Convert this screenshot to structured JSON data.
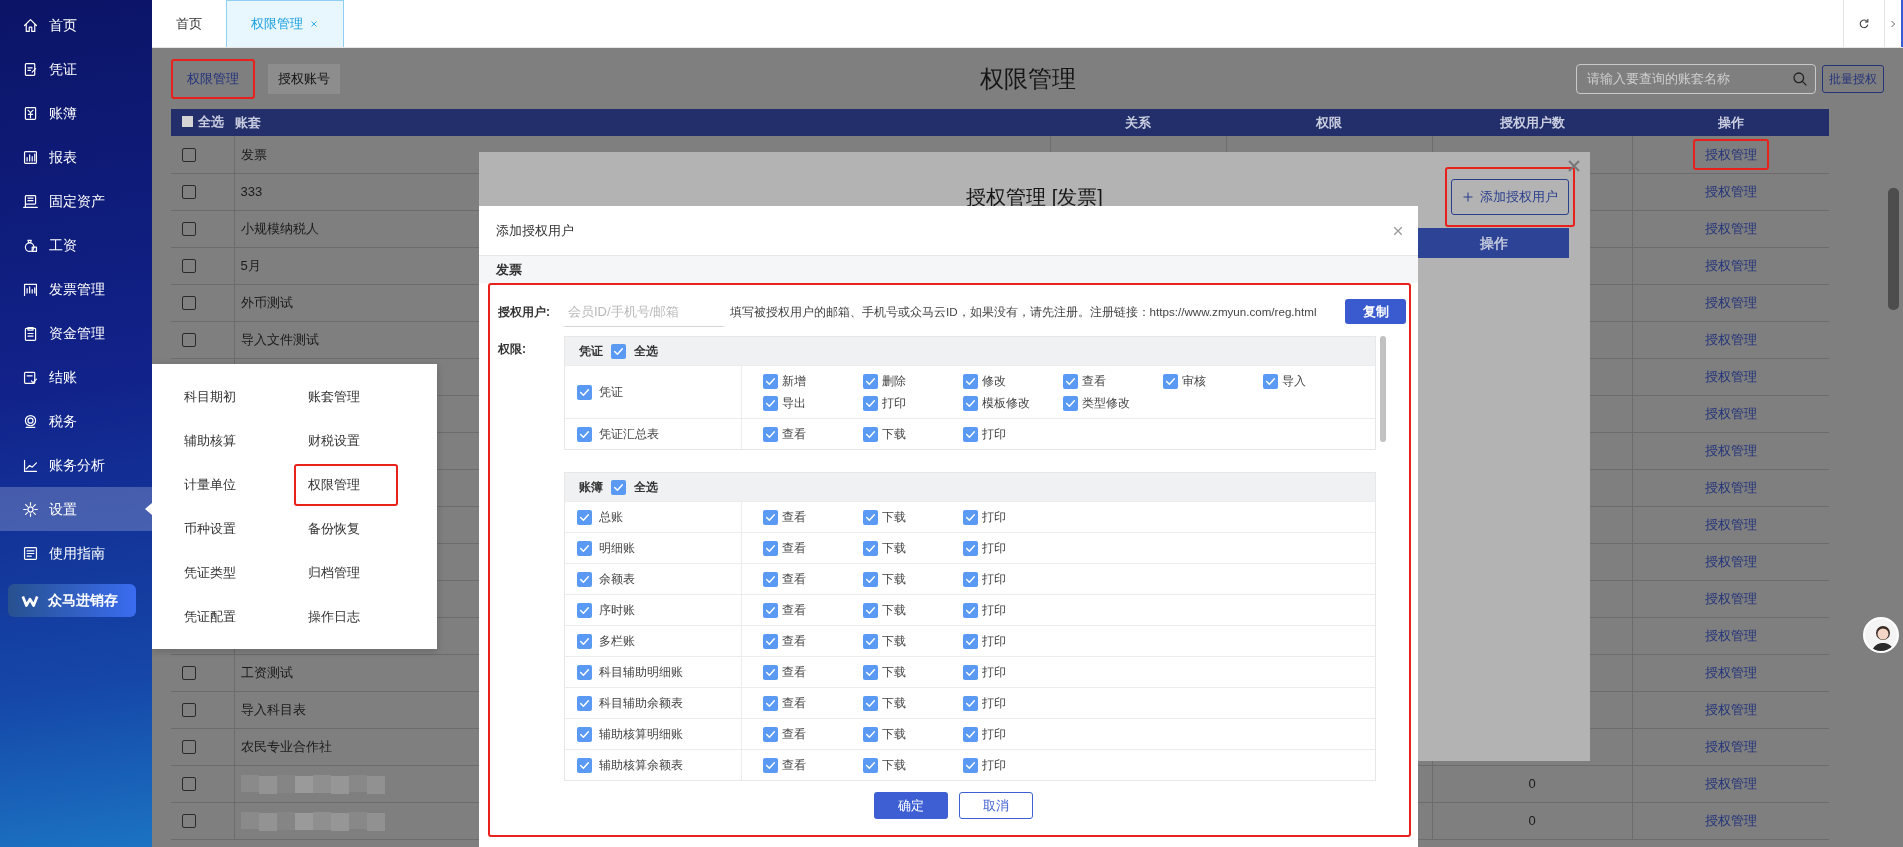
{
  "sidebar": {
    "items": [
      {
        "label": "首页",
        "selected": false
      },
      {
        "label": "凭证",
        "selected": false
      },
      {
        "label": "账簿",
        "selected": false
      },
      {
        "label": "报表",
        "selected": false
      },
      {
        "label": "固定资产",
        "selected": false
      },
      {
        "label": "工资",
        "selected": false
      },
      {
        "label": "发票管理",
        "selected": false
      },
      {
        "label": "资金管理",
        "selected": false
      },
      {
        "label": "结账",
        "selected": false
      },
      {
        "label": "税务",
        "selected": false
      },
      {
        "label": "账务分析",
        "selected": false
      },
      {
        "label": "设置",
        "selected": true
      },
      {
        "label": "使用指南",
        "selected": false
      }
    ],
    "brand_button": "众马进销存"
  },
  "tabs": [
    {
      "label": "首页",
      "selected": false,
      "closable": false
    },
    {
      "label": "权限管理",
      "selected": true,
      "closable": true
    }
  ],
  "page": {
    "subtabs": [
      {
        "label": "权限管理",
        "selected": true,
        "highlighted": true
      },
      {
        "label": "授权账号",
        "selected": false,
        "highlighted": false
      }
    ],
    "title": "权限管理",
    "search": {
      "placeholder": "请输入要查询的账套名称"
    },
    "batch_button": "批量授权"
  },
  "table": {
    "select_all": {
      "label": "全选",
      "checked": false
    },
    "columns": [
      "账套",
      "关系",
      "权限",
      "授权用户数",
      "操作"
    ],
    "rows": [
      {
        "kind": "normal",
        "checked": false,
        "account": "发票",
        "action": {
          "label": "授权管理",
          "highlighted": true
        }
      },
      {
        "kind": "normal",
        "checked": false,
        "account": "333",
        "action": {
          "label": "授权管理",
          "highlighted": false
        }
      },
      {
        "kind": "normal",
        "checked": false,
        "account": "小规模纳税人",
        "action": {
          "label": "授权管理",
          "highlighted": false
        }
      },
      {
        "kind": "normal",
        "checked": false,
        "account": "5月",
        "action": {
          "label": "授权管理",
          "highlighted": false
        }
      },
      {
        "kind": "normal",
        "checked": false,
        "account": "外币测试",
        "action": {
          "label": "授权管理",
          "highlighted": false
        }
      },
      {
        "kind": "normal",
        "checked": false,
        "account": "导入文件测试",
        "action": {
          "label": "授权管理",
          "highlighted": false
        }
      },
      {
        "kind": "covered",
        "action": {
          "label": "授权管理",
          "highlighted": false
        }
      },
      {
        "kind": "covered",
        "action": {
          "label": "授权管理",
          "highlighted": false
        }
      },
      {
        "kind": "covered",
        "action": {
          "label": "授权管理",
          "highlighted": false
        }
      },
      {
        "kind": "covered",
        "action": {
          "label": "授权管理",
          "highlighted": false
        }
      },
      {
        "kind": "covered",
        "action": {
          "label": "授权管理",
          "highlighted": false
        }
      },
      {
        "kind": "covered",
        "action": {
          "label": "授权管理",
          "highlighted": false
        }
      },
      {
        "kind": "covered",
        "action": {
          "label": "授权管理",
          "highlighted": false
        }
      },
      {
        "kind": "covered",
        "action": {
          "label": "授权管理",
          "highlighted": false
        }
      },
      {
        "kind": "normal",
        "checked": false,
        "account": "工资测试",
        "action": {
          "label": "授权管理",
          "highlighted": false
        }
      },
      {
        "kind": "normal",
        "checked": false,
        "account": "导入科目表",
        "action": {
          "label": "授权管理",
          "highlighted": false
        }
      },
      {
        "kind": "normal",
        "checked": false,
        "account": "农民专业合作社",
        "action": {
          "label": "授权管理",
          "highlighted": false
        }
      },
      {
        "kind": "blurred",
        "checked": false,
        "users": "0",
        "action": {
          "label": "授权管理",
          "highlighted": false
        }
      },
      {
        "kind": "blurred",
        "checked": false,
        "users": "0",
        "action": {
          "label": "授权管理",
          "highlighted": false
        }
      }
    ]
  },
  "settings_menu": {
    "items": [
      {
        "label": "科目期初",
        "highlighted": false
      },
      {
        "label": "账套管理",
        "highlighted": false
      },
      {
        "label": "辅助核算",
        "highlighted": false
      },
      {
        "label": "财税设置",
        "highlighted": false
      },
      {
        "label": "计量单位",
        "highlighted": false
      },
      {
        "label": "权限管理",
        "highlighted": true
      },
      {
        "label": "币种设置",
        "highlighted": false
      },
      {
        "label": "备份恢复",
        "highlighted": false
      },
      {
        "label": "凭证类型",
        "highlighted": false
      },
      {
        "label": "归档管理",
        "highlighted": false
      },
      {
        "label": "凭证配置",
        "highlighted": false
      },
      {
        "label": "操作日志",
        "highlighted": false
      }
    ]
  },
  "manage_dialog": {
    "title": "授权管理 [发票]",
    "add_button": {
      "label": "添加授权用户",
      "highlighted": true
    },
    "columns": [
      "操作"
    ]
  },
  "add_user_dialog": {
    "title": "添加授权用户",
    "account": "发票",
    "highlighted": true,
    "user_label": "授权用户:",
    "user_placeholder": "会员ID/手机号/邮箱",
    "hint": "填写被授权用户的邮箱、手机号或众马云ID，如果没有，请先注册。注册链接：https://www.zmyun.com/reg.html",
    "copy_button": "复制",
    "permission_label": "权限:",
    "groups": [
      {
        "name": "凭证",
        "select_all": {
          "label": "全选",
          "checked": true
        },
        "items": [
          {
            "name": "凭证",
            "checked": true,
            "options": [
              {
                "label": "新增",
                "checked": true
              },
              {
                "label": "删除",
                "checked": true
              },
              {
                "label": "修改",
                "checked": true
              },
              {
                "label": "查看",
                "checked": true
              },
              {
                "label": "审核",
                "checked": true
              },
              {
                "label": "导入",
                "checked": true
              },
              {
                "label": "导出",
                "checked": true
              },
              {
                "label": "打印",
                "checked": true
              },
              {
                "label": "模板修改",
                "checked": true
              },
              {
                "label": "类型修改",
                "checked": true
              }
            ]
          },
          {
            "name": "凭证汇总表",
            "checked": true,
            "options": [
              {
                "label": "查看",
                "checked": true
              },
              {
                "label": "下载",
                "checked": true
              },
              {
                "label": "打印",
                "checked": true
              }
            ]
          }
        ]
      },
      {
        "name": "账簿",
        "select_all": {
          "label": "全选",
          "checked": true
        },
        "items": [
          {
            "name": "总账",
            "checked": true,
            "options": [
              {
                "label": "查看",
                "checked": true
              },
              {
                "label": "下载",
                "checked": true
              },
              {
                "label": "打印",
                "checked": true
              }
            ]
          },
          {
            "name": "明细账",
            "checked": true,
            "options": [
              {
                "label": "查看",
                "checked": true
              },
              {
                "label": "下载",
                "checked": true
              },
              {
                "label": "打印",
                "checked": true
              }
            ]
          },
          {
            "name": "余额表",
            "checked": true,
            "options": [
              {
                "label": "查看",
                "checked": true
              },
              {
                "label": "下载",
                "checked": true
              },
              {
                "label": "打印",
                "checked": true
              }
            ]
          },
          {
            "name": "序时账",
            "checked": true,
            "options": [
              {
                "label": "查看",
                "checked": true
              },
              {
                "label": "下载",
                "checked": true
              },
              {
                "label": "打印",
                "checked": true
              }
            ]
          },
          {
            "name": "多栏账",
            "checked": true,
            "options": [
              {
                "label": "查看",
                "checked": true
              },
              {
                "label": "下载",
                "checked": true
              },
              {
                "label": "打印",
                "checked": true
              }
            ]
          },
          {
            "name": "科目辅助明细账",
            "checked": true,
            "options": [
              {
                "label": "查看",
                "checked": true
              },
              {
                "label": "下载",
                "checked": true
              },
              {
                "label": "打印",
                "checked": true
              }
            ]
          },
          {
            "name": "科目辅助余额表",
            "checked": true,
            "options": [
              {
                "label": "查看",
                "checked": true
              },
              {
                "label": "下载",
                "checked": true
              },
              {
                "label": "打印",
                "checked": true
              }
            ]
          },
          {
            "name": "辅助核算明细账",
            "checked": true,
            "options": [
              {
                "label": "查看",
                "checked": true
              },
              {
                "label": "下载",
                "checked": true
              },
              {
                "label": "打印",
                "checked": true
              }
            ]
          },
          {
            "name": "辅助核算余额表",
            "checked": true,
            "options": [
              {
                "label": "查看",
                "checked": true
              },
              {
                "label": "下载",
                "checked": true
              },
              {
                "label": "打印",
                "checked": true
              }
            ]
          }
        ]
      }
    ],
    "confirm_button": "确定",
    "cancel_button": "取消"
  }
}
